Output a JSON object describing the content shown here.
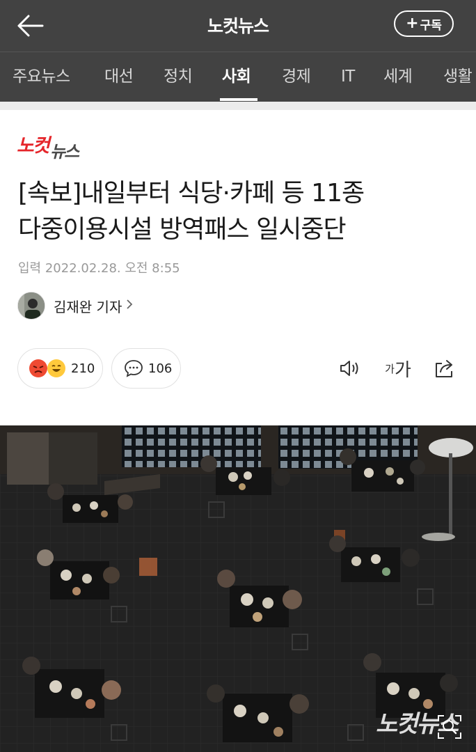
{
  "header": {
    "title": "노컷뉴스",
    "subscribe_label": "구독",
    "back_icon": "back-arrow-icon"
  },
  "tabs": [
    {
      "label": "주요뉴스",
      "active": false
    },
    {
      "label": "대선",
      "active": false
    },
    {
      "label": "정치",
      "active": false
    },
    {
      "label": "사회",
      "active": true
    },
    {
      "label": "경제",
      "active": false
    },
    {
      "label": "IT",
      "active": false
    },
    {
      "label": "세계",
      "active": false
    },
    {
      "label": "생활",
      "active": false
    }
  ],
  "article": {
    "logo_text": "노컷뉴스",
    "headline_line1": "[속보]내일부터 식당·카페 등 11종",
    "headline_line2": "다중이용시설 방역패스 일시중단",
    "dateline": "입력 2022.02.28. 오전 8:55",
    "author_name": "김재완 기자"
  },
  "actions": {
    "reaction_count": "210",
    "comment_count": "106",
    "font_size_label_small": "가",
    "font_size_label_large": "가"
  },
  "photo": {
    "watermark": "노컷뉴스"
  },
  "colors": {
    "header_bg": "#424242",
    "brand_red": "#e5262b",
    "brand_gray": "#4a4a4a"
  }
}
